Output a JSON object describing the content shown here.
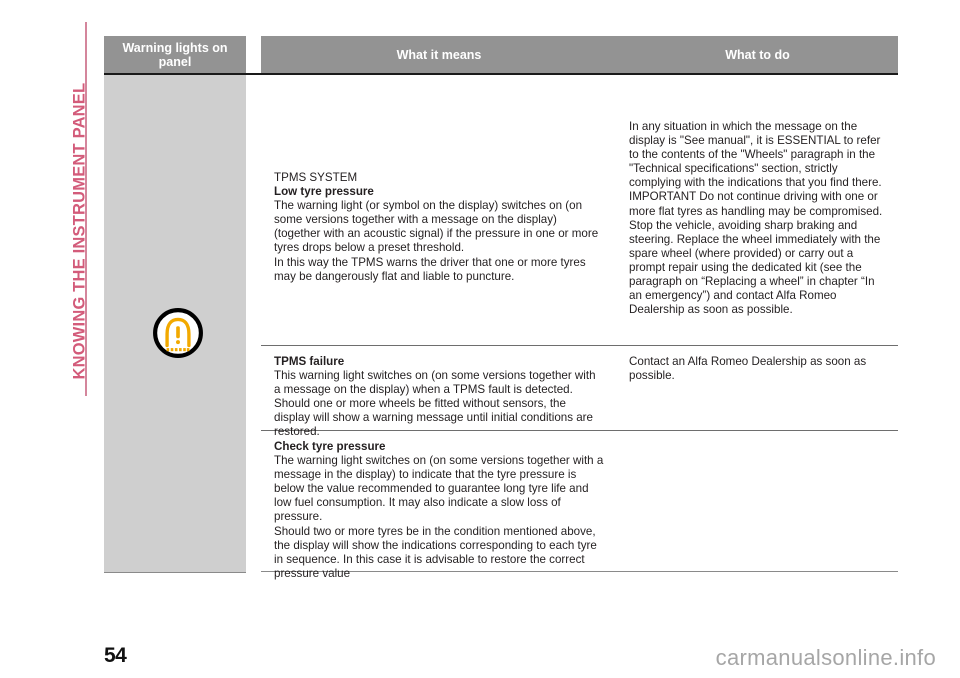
{
  "chapter": {
    "label": "KNOWING THE INSTRUMENT PANEL",
    "color": "#d35b7a"
  },
  "table": {
    "headers": {
      "col1": "Warning lights on panel",
      "col2": "What it means",
      "col3": "What to do"
    },
    "header_bg": "#939393",
    "icon_column_bg": "#cfcfcf",
    "rows": [
      {
        "icon": "tpms-warning-icon",
        "icon_colors": {
          "ring": "#000000",
          "symbol": "#f2a900"
        },
        "means": {
          "title_plain": "TPMS SYSTEM",
          "title_bold": "Low tyre pressure",
          "body": "The warning light (or symbol on the display) switches on (on some versions together with a message on the display) (together with an acoustic signal) if the pressure in one or more tyres drops below a preset threshold.\nIn this way the TPMS warns the driver that one or more tyres may be dangerously flat and liable to puncture."
        },
        "todo": {
          "body": "In any situation in which the message on the display is \"See manual\", it is ESSENTIAL to refer to the contents of the \"Wheels\" paragraph in the \"Technical specifications\" section, strictly complying with the indications that you find there.\nIMPORTANT Do not continue driving with one or more flat tyres as handling may be compromised. Stop the vehicle, avoiding sharp braking and steering. Replace the wheel immediately with the spare wheel (where provided) or carry out a prompt repair using the dedicated kit (see the paragraph on “Replacing a wheel” in chapter “In an emergency”) and contact Alfa Romeo Dealership as soon as possible."
        }
      },
      {
        "icon": "",
        "means": {
          "title_bold": "TPMS failure",
          "body": "This warning light switches on (on some versions together with a message on the display) when a TPMS fault is detected.\nShould one or more wheels be fitted without sensors, the display will show a warning message until initial conditions are restored."
        },
        "todo": {
          "body": "Contact an Alfa Romeo Dealership as soon as possible."
        }
      },
      {
        "icon": "",
        "means": {
          "title_bold": "Check tyre pressure",
          "body": "The warning light switches on (on some versions together with a message in the display) to indicate that the tyre pressure is below the value recommended to guarantee long tyre life and low fuel consumption. It may also indicate a slow loss of pressure.\nShould two or more tyres be in the condition mentioned above, the display will show the indications corresponding to each tyre in sequence. In this case it is advisable to restore the correct pressure value"
        },
        "todo": {
          "body": ""
        }
      }
    ]
  },
  "footer": {
    "page_number": "54",
    "watermark": "carmanualsonline.info"
  }
}
